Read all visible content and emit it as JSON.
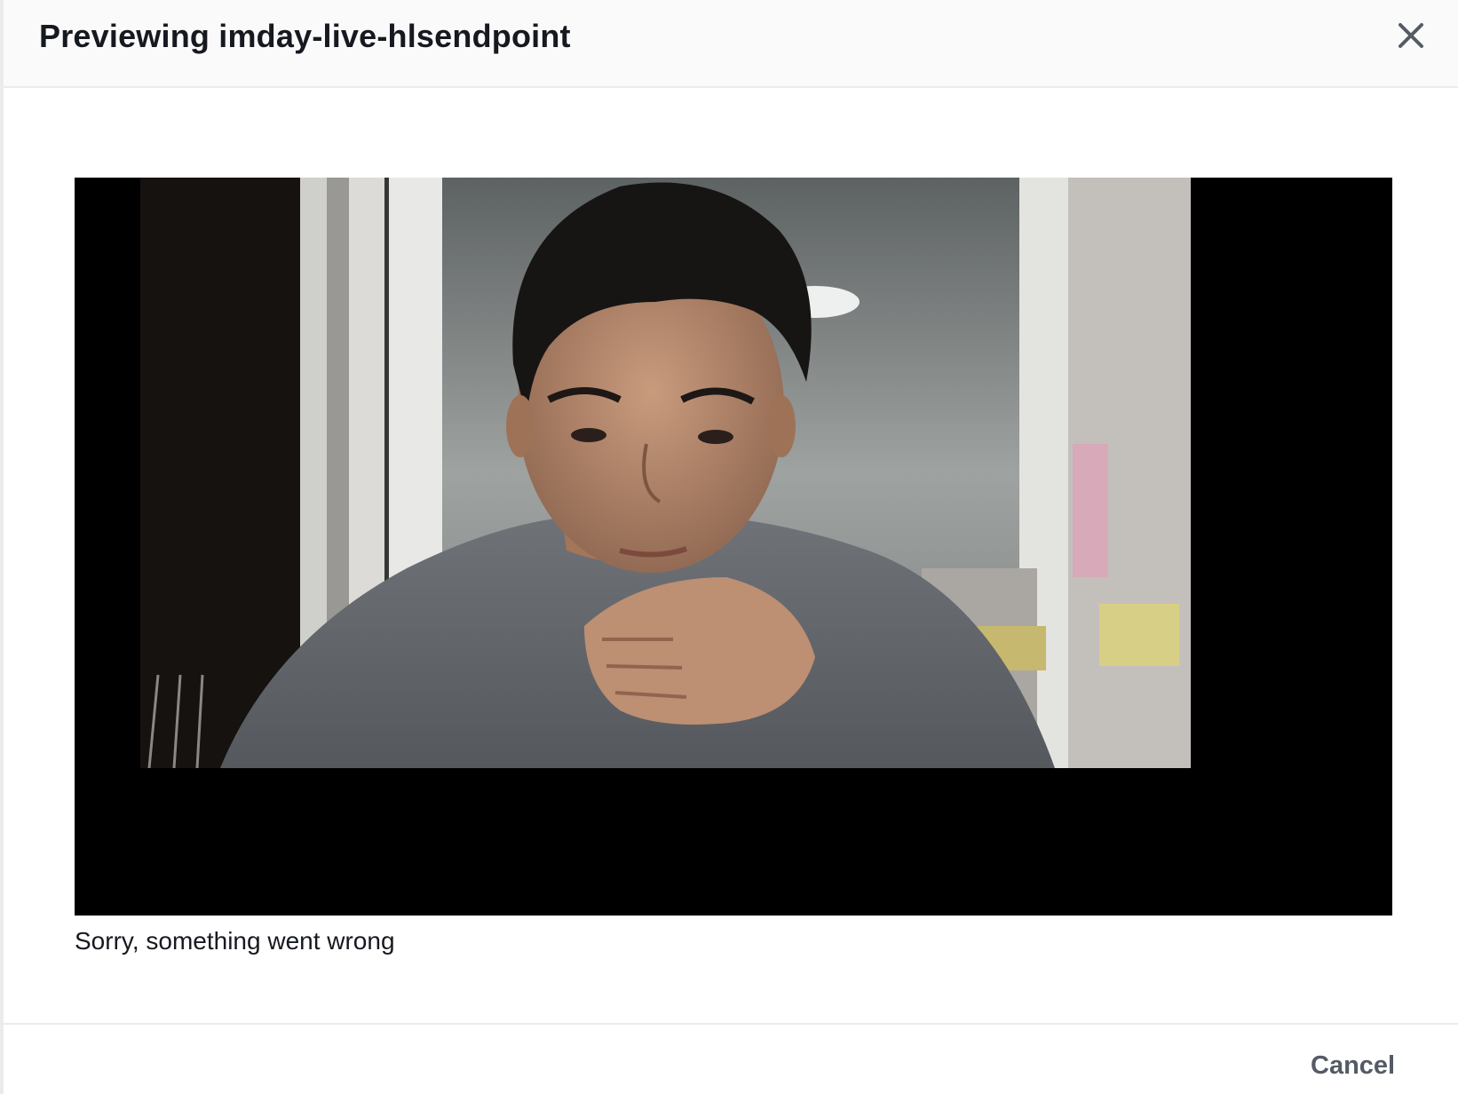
{
  "modal": {
    "title": "Previewing imday-live-hlsendpoint",
    "close_icon": "close-icon"
  },
  "player": {
    "error_message": "Sorry, something went wrong"
  },
  "footer": {
    "cancel_label": "Cancel"
  },
  "colors": {
    "header_bg": "#fafafa",
    "border": "#e9ebed",
    "title_text": "#16191f",
    "cancel_text": "#545b64",
    "player_bg": "#000000"
  }
}
